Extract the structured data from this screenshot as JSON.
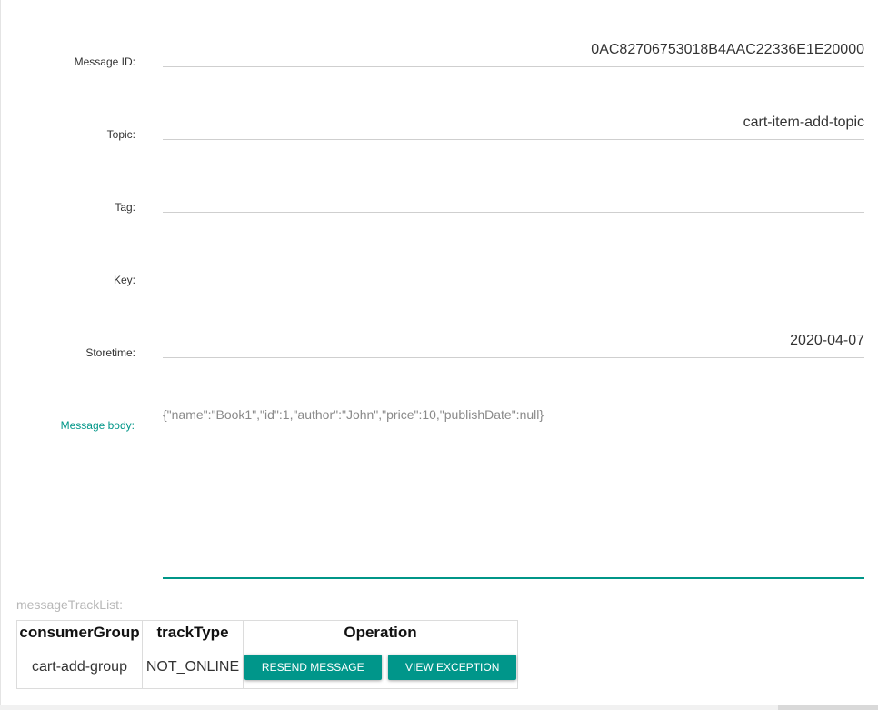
{
  "fields": {
    "message_id": {
      "label": "Message ID:",
      "value": "0AC82706753018B4AAC22336E1E20000"
    },
    "topic": {
      "label": "Topic:",
      "value": "cart-item-add-topic"
    },
    "tag": {
      "label": "Tag:",
      "value": ""
    },
    "key": {
      "label": "Key:",
      "value": ""
    },
    "storetime": {
      "label": "Storetime:",
      "value": "2020-04-07"
    },
    "message_body": {
      "label": "Message body:",
      "value": "{\"name\":\"Book1\",\"id\":1,\"author\":\"John\",\"price\":10,\"publishDate\":null}"
    }
  },
  "track_list": {
    "label": "messageTrackList:",
    "headers": [
      "consumerGroup",
      "trackType",
      "Operation"
    ],
    "rows": [
      {
        "consumer_group": "cart-add-group",
        "track_type": "NOT_ONLINE",
        "resend_label": "RESEND MESSAGE",
        "exception_label": "VIEW EXCEPTION"
      }
    ]
  },
  "colors": {
    "accent": "#009688",
    "button": "#00968a"
  }
}
